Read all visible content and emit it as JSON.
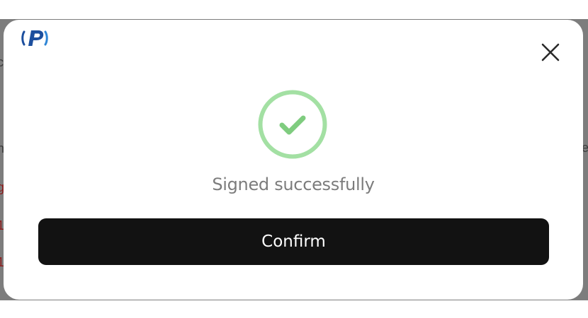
{
  "dialog": {
    "message": "Signed successfully",
    "confirm_label": "Confirm",
    "close_icon": "close-icon",
    "status_icon": "check-circle-icon",
    "logo_icon": "brand-logo-p-icon"
  },
  "colors": {
    "success_ring": "#a3e0a3",
    "success_check": "#7fcc7f",
    "button_bg": "#121212",
    "button_text": "#ffffff",
    "message_text": "#7c7c7c",
    "brand_blue": "#1c4f9e",
    "overlay": "#7d7d7d"
  }
}
